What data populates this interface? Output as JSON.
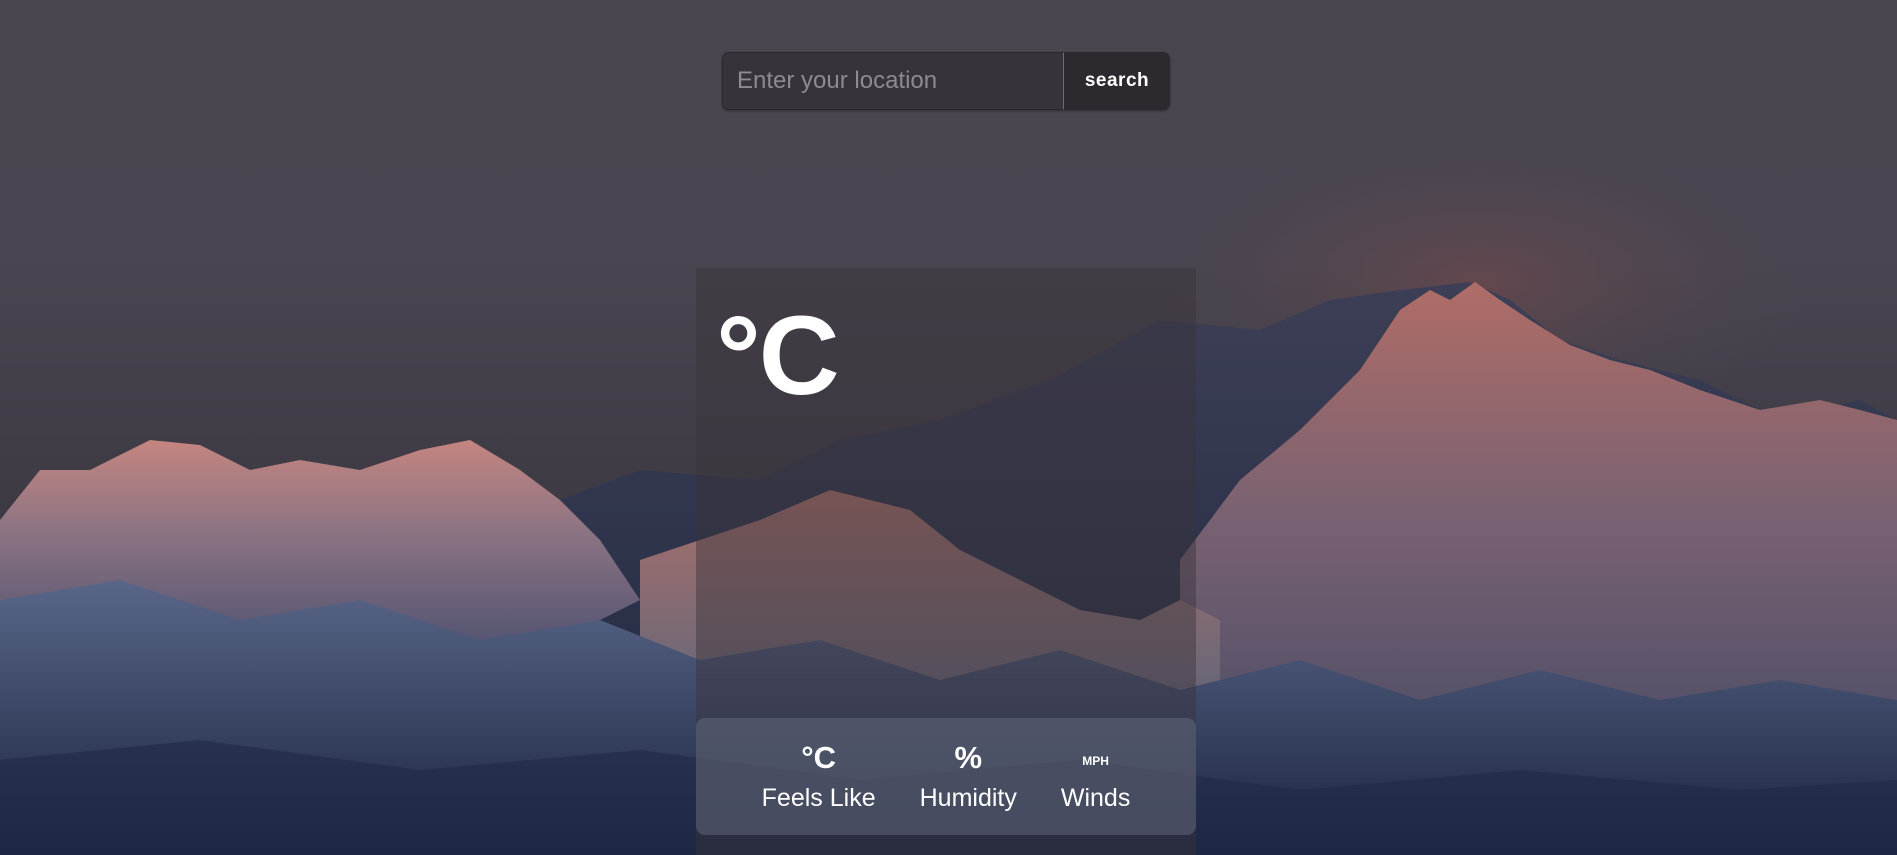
{
  "search": {
    "placeholder": "Enter your location",
    "value": "",
    "button_label": "search"
  },
  "current": {
    "temperature": "°C"
  },
  "stats": [
    {
      "value": "°C",
      "label": "Feels Like"
    },
    {
      "value": "%",
      "label": "Humidity"
    },
    {
      "value": "MPH",
      "label": "Winds"
    }
  ],
  "colors": {
    "sky": "#4a464f",
    "panel": "#3a343a",
    "text": "#ffffff"
  }
}
